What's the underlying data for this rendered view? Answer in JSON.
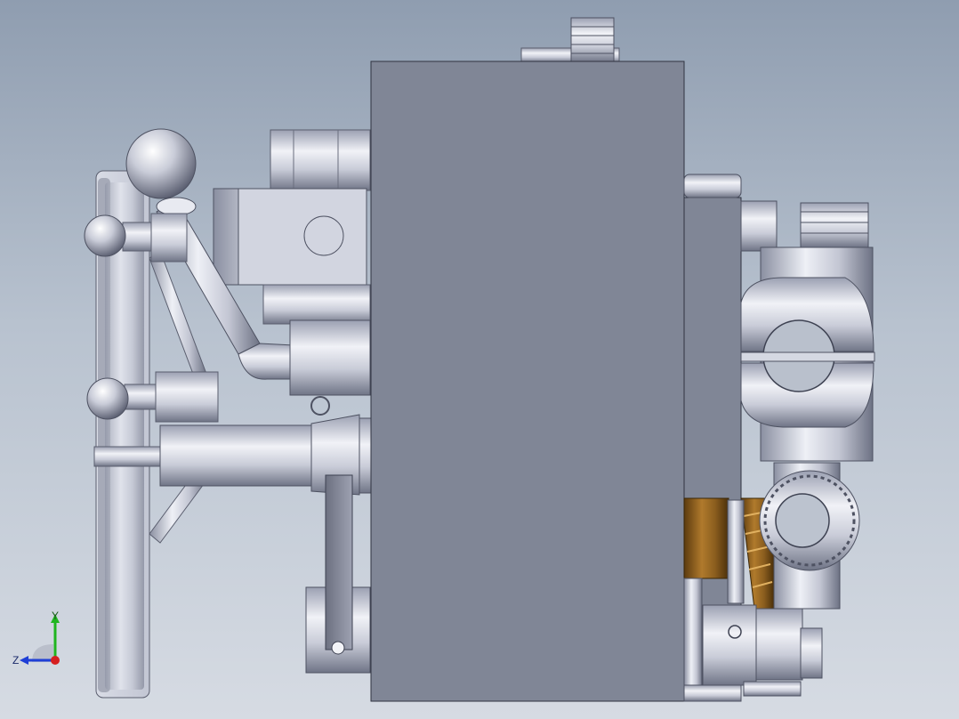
{
  "scene": {
    "background_top": "#8f9db0",
    "background_bottom": "#d6dbe3",
    "part_color": "#808696",
    "metal_light": "#e6e8f0",
    "metal_dark": "#7f8496",
    "bronze_color": "#8a5d1e"
  },
  "triad": {
    "y_label": "Y",
    "z_label": "Z",
    "y_color": "#1fb51f",
    "z_color": "#1f3fd6",
    "x_color": "#d61f1f"
  }
}
